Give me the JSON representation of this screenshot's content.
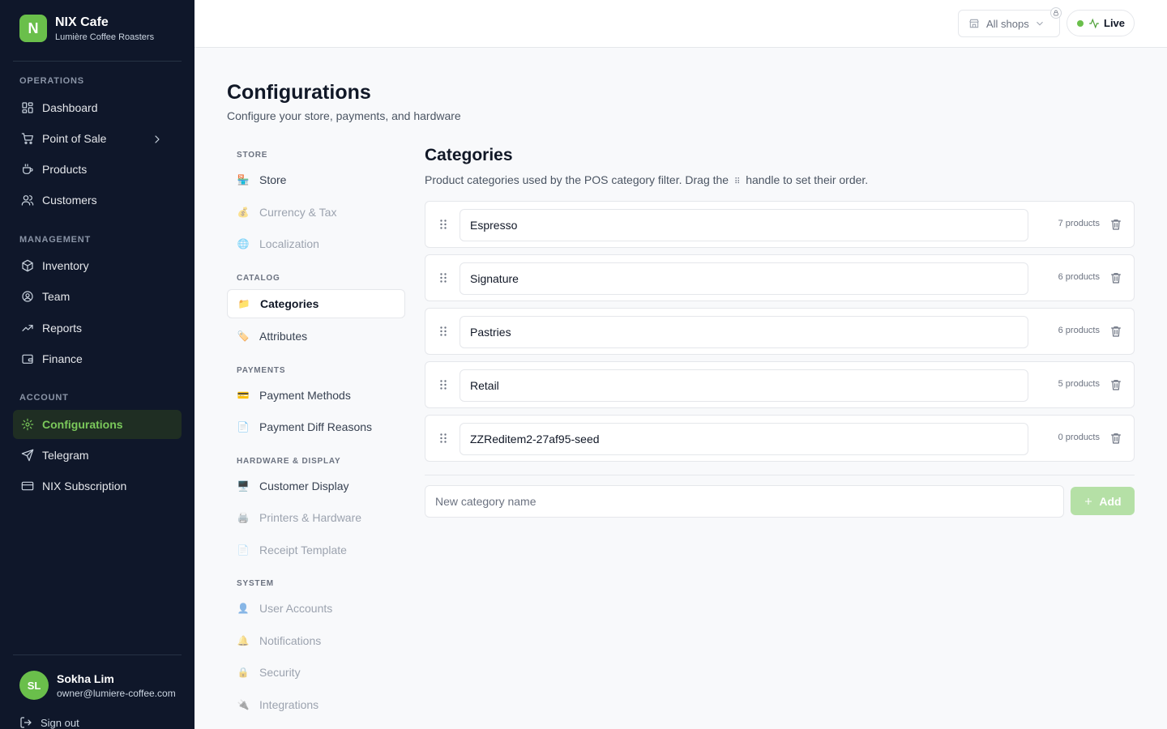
{
  "brand": {
    "initial": "N",
    "name": "NIX Cafe",
    "subtitle": "Lumière Coffee Roasters"
  },
  "sidebar": {
    "sections": [
      {
        "label": "OPERATIONS"
      },
      {
        "label": "MANAGEMENT"
      },
      {
        "label": "ACCOUNT"
      }
    ],
    "items": [
      {
        "label": "Dashboard",
        "icon": "dashboard-icon"
      },
      {
        "label": "Point of Sale",
        "icon": "cart-icon"
      },
      {
        "label": "Products",
        "icon": "cup-icon"
      },
      {
        "label": "Customers",
        "icon": "users-icon"
      },
      {
        "label": "Inventory",
        "icon": "box-icon"
      },
      {
        "label": "Team",
        "icon": "user-circle-icon"
      },
      {
        "label": "Reports",
        "icon": "trend-icon"
      },
      {
        "label": "Finance",
        "icon": "wallet-icon"
      },
      {
        "label": "Configurations",
        "icon": "gear-icon",
        "active": true
      },
      {
        "label": "Telegram",
        "icon": "send-icon"
      },
      {
        "label": "NIX Subscription",
        "icon": "card-icon"
      }
    ],
    "user": {
      "initials": "SL",
      "name": "Sokha Lim",
      "email": "owner@lumiere-coffee.com"
    },
    "signout_label": "Sign out"
  },
  "topbar": {
    "shop_select": "All shops",
    "live_label": "Live"
  },
  "page": {
    "title": "Configurations",
    "subtitle": "Configure your store, payments, and hardware"
  },
  "settings_nav": {
    "groups": [
      {
        "label": "STORE"
      },
      {
        "label": "CATALOG"
      },
      {
        "label": "PAYMENTS"
      },
      {
        "label": "HARDWARE & DISPLAY"
      },
      {
        "label": "SYSTEM"
      }
    ],
    "items": [
      {
        "label": "Store",
        "emoji": "🏪"
      },
      {
        "label": "Currency & Tax",
        "emoji": "💰"
      },
      {
        "label": "Localization",
        "emoji": "🌐"
      },
      {
        "label": "Categories",
        "emoji": "📁"
      },
      {
        "label": "Attributes",
        "emoji": "🏷️"
      },
      {
        "label": "Payment Methods",
        "emoji": "💳"
      },
      {
        "label": "Payment Diff Reasons",
        "emoji": "📄"
      },
      {
        "label": "Customer Display",
        "emoji": "🖥️"
      },
      {
        "label": "Printers & Hardware",
        "emoji": "🖨️"
      },
      {
        "label": "Receipt Template",
        "emoji": "📄"
      },
      {
        "label": "User Accounts",
        "emoji": "👤"
      },
      {
        "label": "Notifications",
        "emoji": "🔔"
      },
      {
        "label": "Security",
        "emoji": "🔒"
      },
      {
        "label": "Integrations",
        "emoji": "🔌"
      }
    ]
  },
  "categories": {
    "title": "Categories",
    "subtitle_before": "Product categories used by the POS category filter. Drag the",
    "subtitle_handle": "⠿",
    "subtitle_after": "handle to set their order.",
    "rows": [
      {
        "name": "Espresso",
        "count": "7 products"
      },
      {
        "name": "Signature",
        "count": "6 products"
      },
      {
        "name": "Pastries",
        "count": "6 products"
      },
      {
        "name": "Retail",
        "count": "5 products"
      },
      {
        "name": "ZZReditem2-27af95-seed",
        "count": "0 products"
      }
    ],
    "new_placeholder": "New category name",
    "add_label": "Add"
  },
  "colors": {
    "sidebar_bg": "#0f172a",
    "accent": "#6abf4b",
    "active_bg": "#1f2e23"
  }
}
